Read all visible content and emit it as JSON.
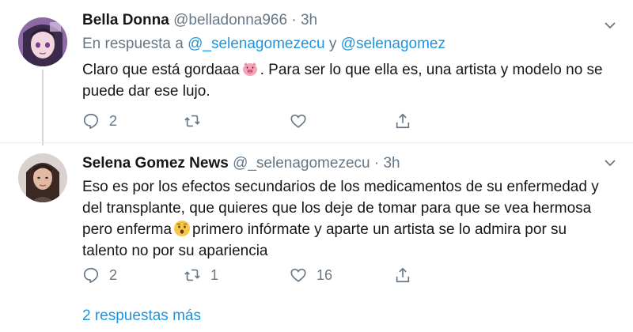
{
  "tweets": [
    {
      "name": "Bella Donna",
      "handle": "@belladonna966",
      "separator": "·",
      "time": "3h",
      "reply_prefix": "En respuesta a ",
      "mention1": "@_selenagomezecu",
      "reply_and": " y ",
      "mention2": "@selenagomez",
      "text_part1": "Claro que está gordaaa",
      "text_part2": ". Para ser lo que ella es, una artista y modelo no se puede dar ese lujo.",
      "replies": "2",
      "retweets": "",
      "likes": ""
    },
    {
      "name": "Selena Gomez News",
      "handle": "@_selenagomezecu",
      "separator": "·",
      "time": "3h",
      "text_part1": "Eso es por los efectos secundarios de los medicamentos de su enfermedad y del transplante, que quieres que los deje de tomar para que se vea hermosa pero enferma",
      "text_part2": "primero infórmate y aparte un artista se lo admira por su talento no por su apariencia",
      "replies": "2",
      "retweets": "1",
      "likes": "16"
    }
  ],
  "more_replies": "2 respuestas más",
  "colors": {
    "link": "#1b95e0",
    "muted": "#657786",
    "text": "#14171a",
    "divider": "#e6ecf0"
  },
  "icons": [
    "pig-face-icon",
    "hushed-face-icon",
    "reply-icon",
    "retweet-icon",
    "like-icon",
    "share-icon",
    "chevron-down-icon"
  ]
}
